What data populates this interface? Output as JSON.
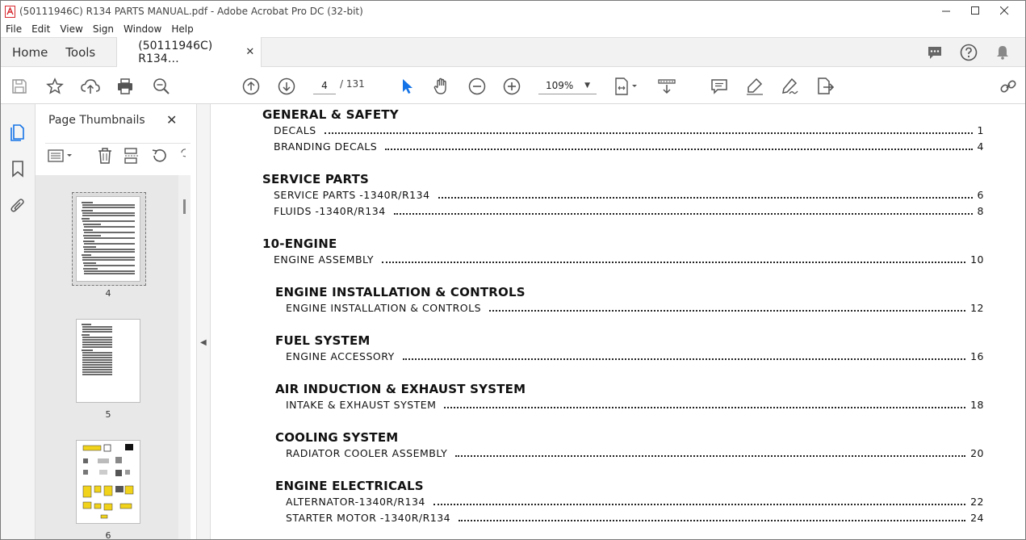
{
  "window": {
    "title": "(50111946C) R134 PARTS MANUAL.pdf - Adobe Acrobat Pro DC (32-bit)"
  },
  "menu": [
    "File",
    "Edit",
    "View",
    "Sign",
    "Window",
    "Help"
  ],
  "tabs": {
    "home": "Home",
    "tools": "Tools",
    "document": "(50111946C) R134…"
  },
  "toolbar": {
    "current_page": "4",
    "total_pages": "/ 131",
    "zoom": "109%"
  },
  "panel": {
    "title": "Page Thumbnails",
    "thumbnails": [
      {
        "label": "4",
        "selected": true
      },
      {
        "label": "5",
        "selected": false
      },
      {
        "label": "6",
        "selected": false
      }
    ]
  },
  "toc": [
    {
      "heading": "GENERAL & SAFETY",
      "level": 1,
      "entries": [
        {
          "label": "DECALS",
          "page": "1"
        },
        {
          "label": "BRANDING DECALS",
          "page": "4"
        }
      ]
    },
    {
      "heading": "SERVICE PARTS",
      "level": 1,
      "entries": [
        {
          "label": "SERVICE PARTS -1340R/R134",
          "page": "6"
        },
        {
          "label": "FLUIDS -1340R/R134",
          "page": "8"
        }
      ]
    },
    {
      "heading": "10-ENGINE",
      "level": 1,
      "entries": [
        {
          "label": "ENGINE ASSEMBLY",
          "page": "10"
        }
      ]
    },
    {
      "heading": "ENGINE INSTALLATION & CONTROLS",
      "level": 2,
      "entries": [
        {
          "label": "ENGINE INSTALLATION & CONTROLS",
          "page": "12"
        }
      ]
    },
    {
      "heading": "FUEL SYSTEM",
      "level": 2,
      "entries": [
        {
          "label": "ENGINE ACCESSORY",
          "page": "16"
        }
      ]
    },
    {
      "heading": "AIR INDUCTION & EXHAUST SYSTEM",
      "level": 2,
      "entries": [
        {
          "label": "INTAKE & EXHAUST SYSTEM",
          "page": "18"
        }
      ]
    },
    {
      "heading": "COOLING SYSTEM",
      "level": 2,
      "entries": [
        {
          "label": "RADIATOR COOLER ASSEMBLY",
          "page": "20"
        }
      ]
    },
    {
      "heading": "ENGINE ELECTRICALS",
      "level": 2,
      "entries": [
        {
          "label": "ALTERNATOR-1340R/R134",
          "page": "22"
        },
        {
          "label": "STARTER MOTOR -1340R/R134",
          "page": "24"
        }
      ]
    }
  ],
  "colors": {
    "accent": "#1473e6",
    "acrobat_red": "#d7282f",
    "panel_bg": "#e8e8e8"
  }
}
